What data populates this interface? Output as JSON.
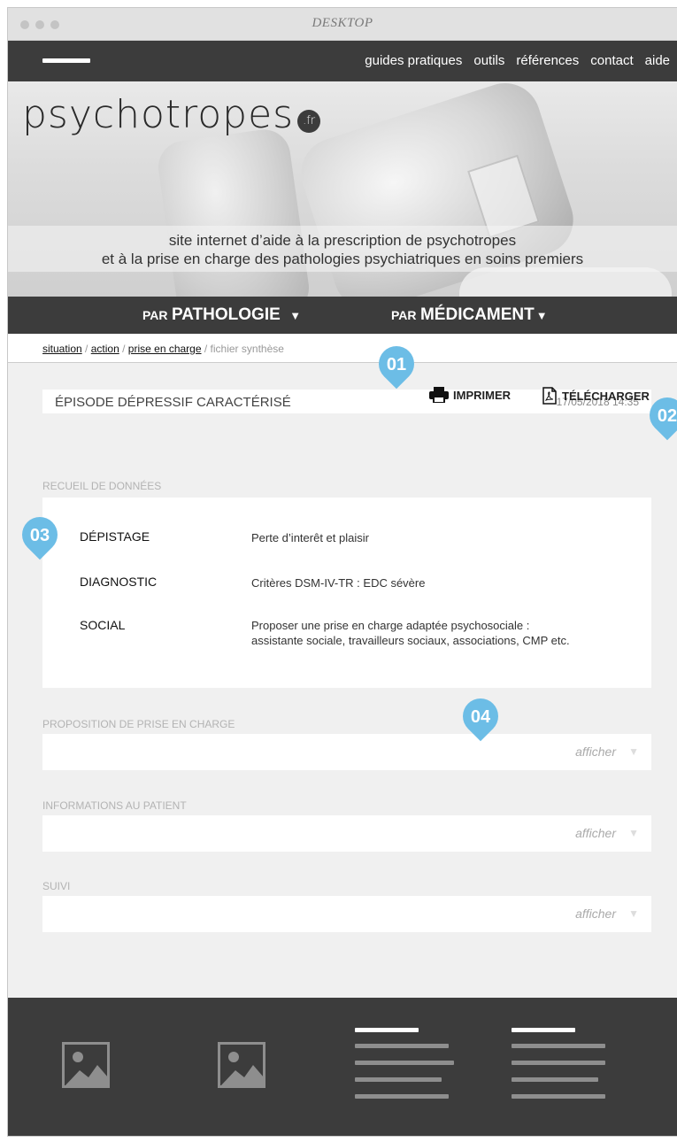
{
  "window": {
    "title": "DESKTOP"
  },
  "topnav": {
    "links": [
      "guides pratiques",
      "outils",
      "références",
      "contact",
      "aide"
    ]
  },
  "hero": {
    "logo": "psychotropes",
    "logo_badge": ".fr",
    "tagline_line1": "site internet d’aide à la prescription de psychotropes",
    "tagline_line2": "et à la prise en charge des pathologies psychiatriques en soins premiers"
  },
  "catnav": {
    "items": [
      {
        "prefix": "PAR",
        "label": "PATHOLOGIE",
        "arrow": "▼"
      },
      {
        "prefix": "PAR",
        "label": "MÉDICAMENT",
        "arrow": "▼"
      }
    ]
  },
  "breadcrumb": {
    "links": [
      "situation",
      "action",
      "prise en charge"
    ],
    "separator": "/",
    "current": "fichier synthèse"
  },
  "episode": {
    "title": "ÉPISODE DÉPRESSIF CARACTÉRISÉ",
    "date": "17/05/2018 14:35"
  },
  "actions": {
    "print_label": "IMPRIMER",
    "download_label": "TÉLÉCHARGER"
  },
  "collect": {
    "label": "RECUEIL DE DONNÉES",
    "rows": [
      {
        "key": "DÉPISTAGE",
        "value": "Perte d’interêt et plaisir"
      },
      {
        "key": "DIAGNOSTIC",
        "value": "Critères DSM-IV-TR : EDC sévère"
      },
      {
        "key": "SOCIAL",
        "value_line1": "Proposer une prise en charge adaptée psychosociale :",
        "value_line2": "assistante sociale, travailleurs sociaux, associations, CMP etc."
      }
    ]
  },
  "sections": [
    {
      "label": "PROPOSITION DE PRISE EN CHARGE",
      "toggle": "afficher"
    },
    {
      "label": "INFORMATIONS AU PATIENT",
      "toggle": "afficher"
    },
    {
      "label": "SUIVI",
      "toggle": "afficher"
    }
  ],
  "markers": [
    "01",
    "02",
    "03",
    "04"
  ],
  "colors": {
    "dark": "#3c3c3c",
    "marker": "#6cbde6",
    "background": "#f0f0f0"
  }
}
